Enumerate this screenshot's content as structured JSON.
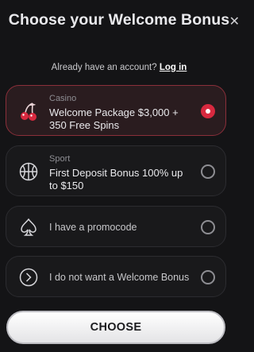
{
  "header": {
    "title": "Choose your Welcome Bonus",
    "close_glyph": "✕"
  },
  "account": {
    "prompt": "Already have an account?",
    "login_label": "Log in"
  },
  "options": [
    {
      "category": "Casino",
      "label": "Welcome Package $3,000 + 350 Free Spins",
      "icon": "cherries-icon",
      "selected": true
    },
    {
      "category": "Sport",
      "label": "First Deposit Bonus 100% up to $150",
      "icon": "basketball-icon",
      "selected": false
    },
    {
      "category": "",
      "label": "I have a promocode",
      "icon": "spade-icon",
      "selected": false
    },
    {
      "category": "",
      "label": "I do not want a Welcome Bonus",
      "icon": "chevron-right-circle-icon",
      "selected": false
    }
  ],
  "colors": {
    "accent": "#d8293f",
    "selected_border": "#8b2f3a",
    "background": "#141416"
  },
  "cta": {
    "label": "CHOOSE"
  }
}
